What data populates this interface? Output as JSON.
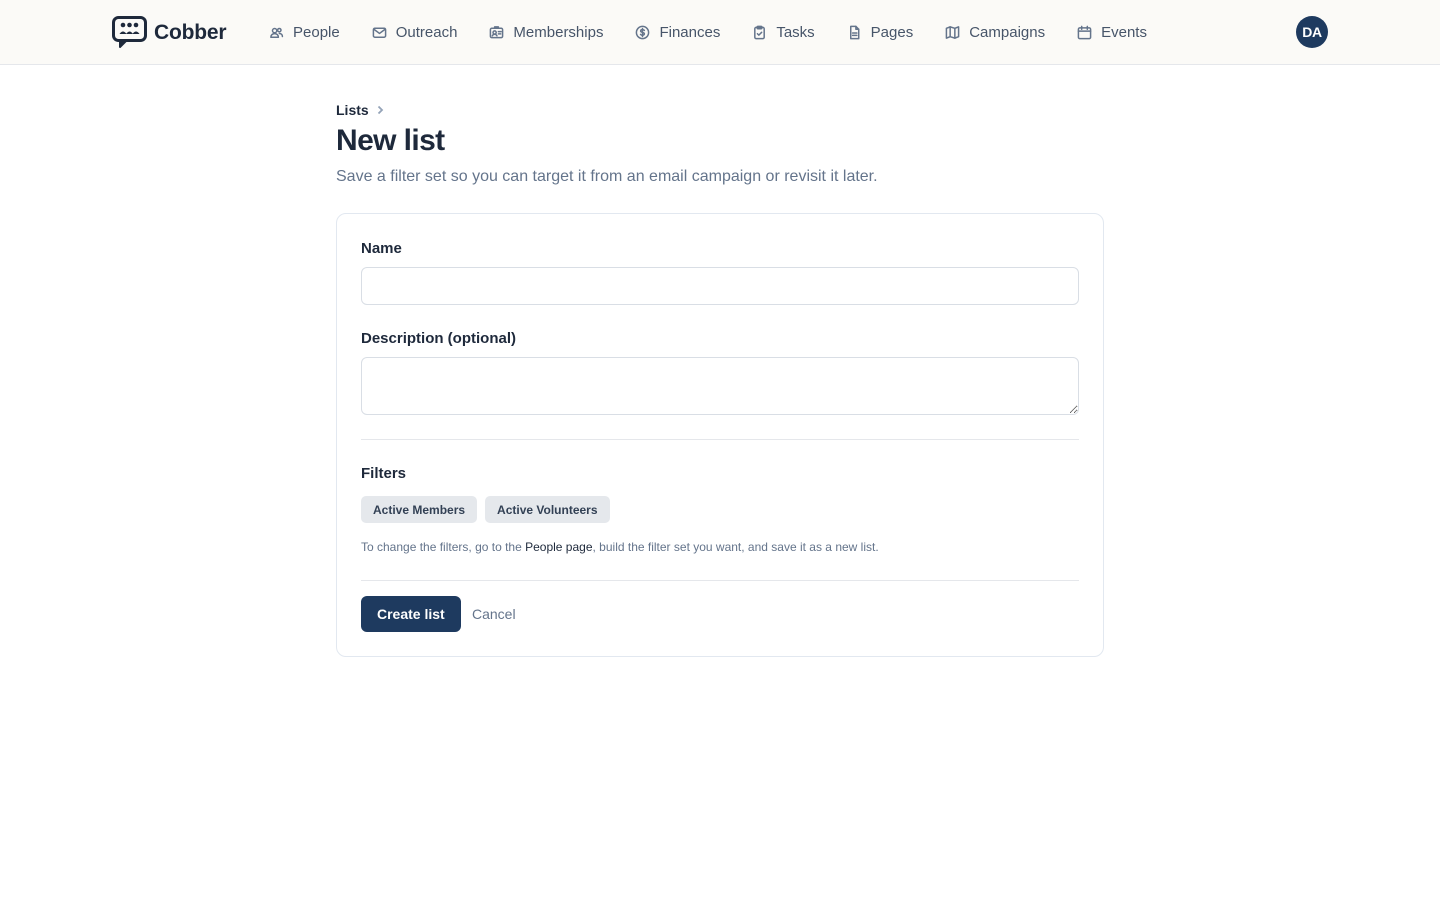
{
  "app": {
    "name": "Cobber",
    "logo_icon": "chat-people-logo-icon"
  },
  "nav": {
    "items": [
      {
        "label": "People",
        "icon": "people-icon"
      },
      {
        "label": "Outreach",
        "icon": "mail-icon"
      },
      {
        "label": "Memberships",
        "icon": "id-card-icon"
      },
      {
        "label": "Finances",
        "icon": "dollar-circle-icon"
      },
      {
        "label": "Tasks",
        "icon": "clipboard-icon"
      },
      {
        "label": "Pages",
        "icon": "document-icon"
      },
      {
        "label": "Campaigns",
        "icon": "map-icon"
      },
      {
        "label": "Events",
        "icon": "calendar-icon"
      }
    ]
  },
  "user": {
    "initials": "DA"
  },
  "breadcrumb": {
    "lists": "Lists"
  },
  "page": {
    "title": "New list",
    "subtitle": "Save a filter set so you can target it from an email campaign or revisit it later."
  },
  "form": {
    "name_label": "Name",
    "name_value": "",
    "description_label": "Description (optional)",
    "description_value": "",
    "filters_label": "Filters",
    "filters": [
      "Active Members",
      "Active Volunteers"
    ],
    "help_before": "To change the filters, go to the ",
    "help_link": "People page",
    "help_after": ", build the filter set you want, and save it as a new list.",
    "submit_label": "Create list",
    "cancel_label": "Cancel"
  },
  "colors": {
    "accent": "#1e3a5f",
    "text": "#1e293b",
    "muted": "#64748b",
    "chip_bg": "#e5e8ec",
    "topbar_bg": "#fbfaf7"
  }
}
